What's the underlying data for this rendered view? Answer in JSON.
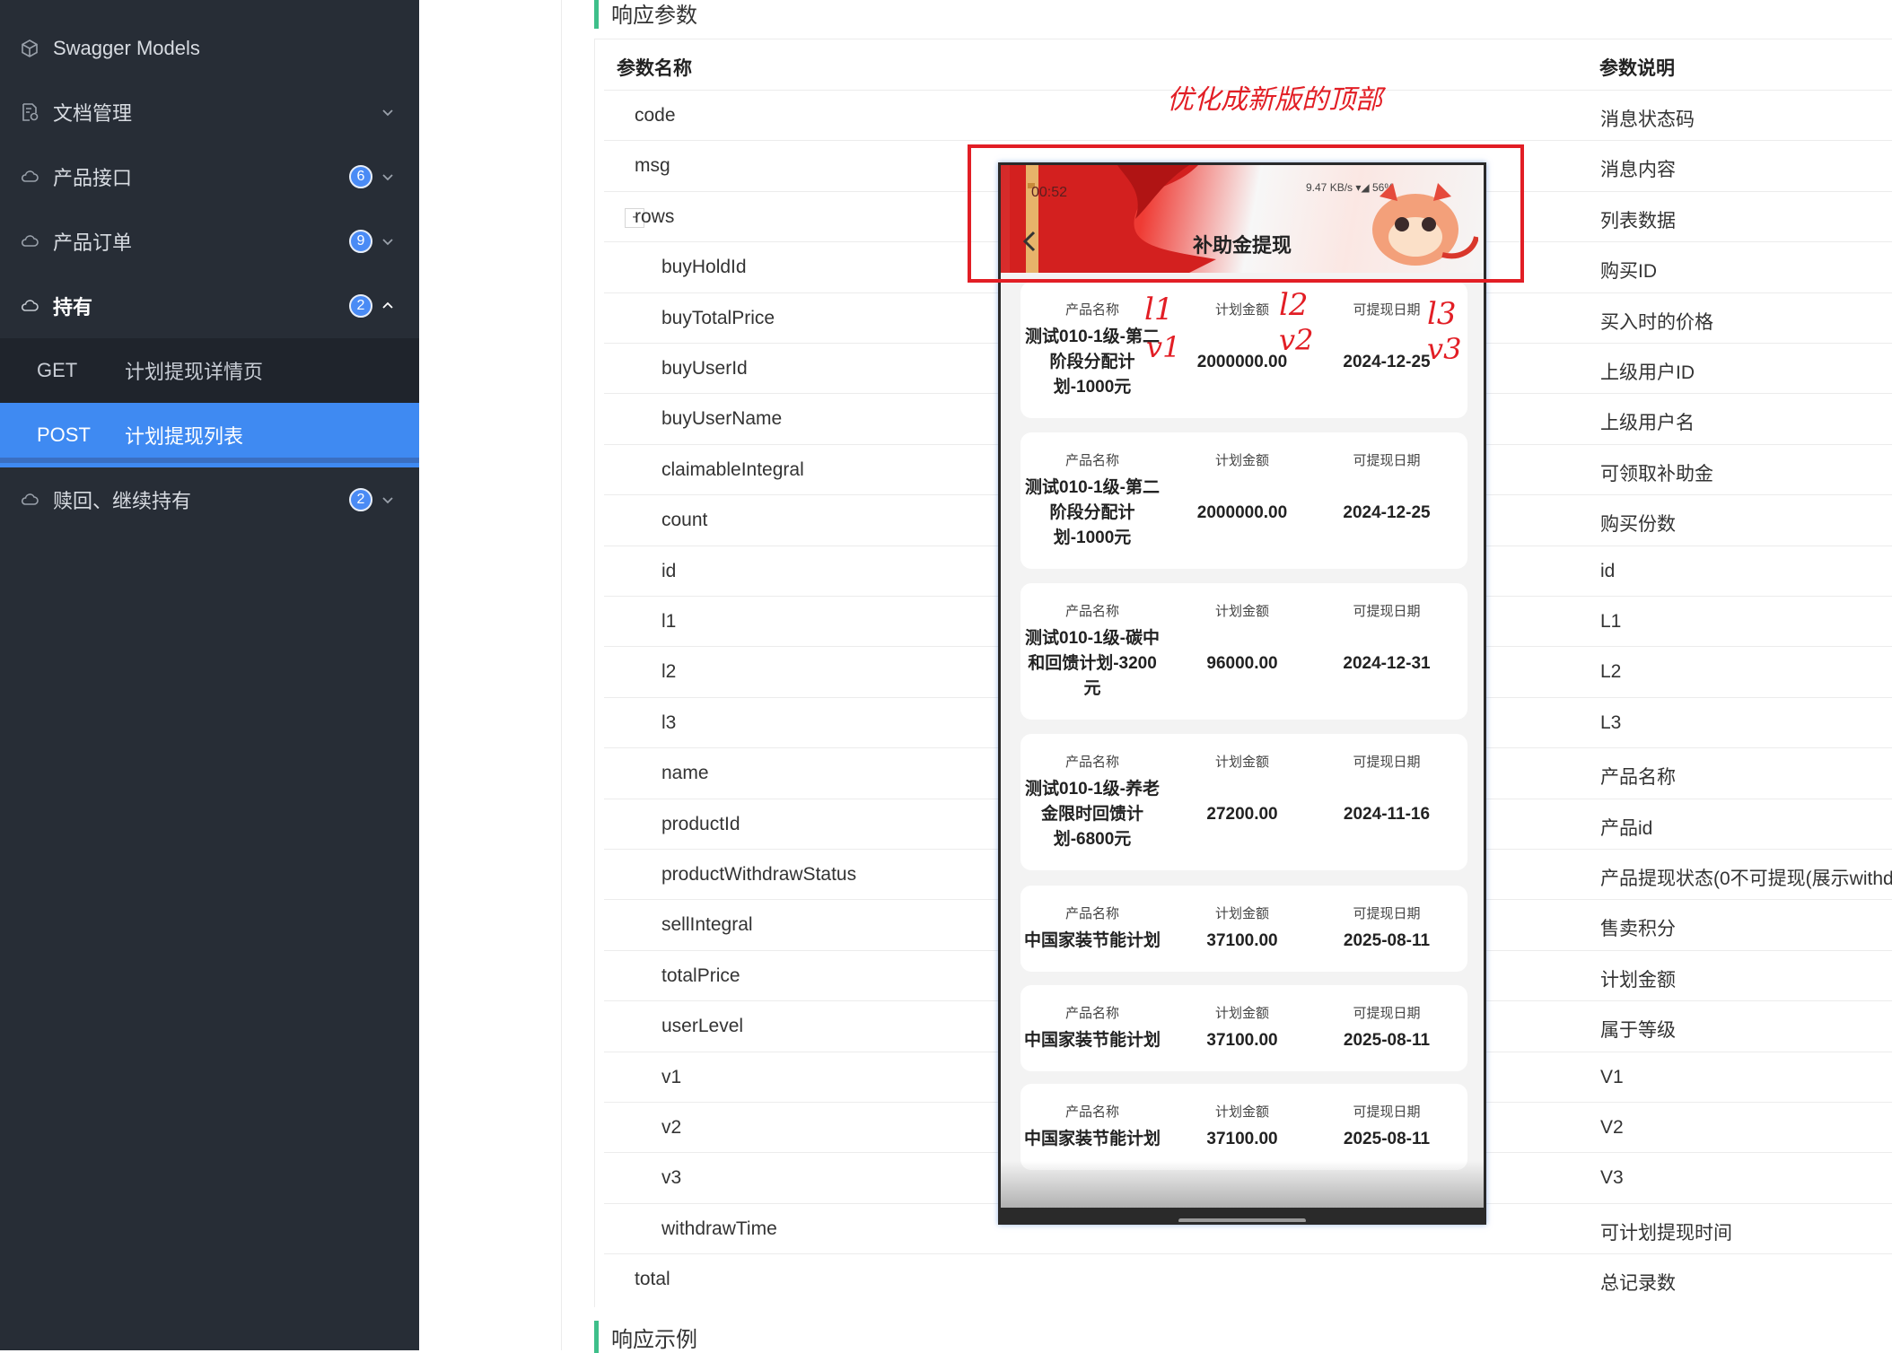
{
  "sidebar": {
    "items": [
      {
        "label": "Swagger Models",
        "badge": "",
        "icon": "cube-icon",
        "chevron": ""
      },
      {
        "label": "文档管理",
        "badge": "",
        "icon": "doc-settings-icon",
        "chevron": "down"
      },
      {
        "label": "产品接口",
        "badge": "6",
        "icon": "cloud-icon",
        "chevron": "down"
      },
      {
        "label": "产品订单",
        "badge": "9",
        "icon": "cloud-icon",
        "chevron": "down"
      },
      {
        "label": "持有",
        "badge": "2",
        "icon": "cloud-icon",
        "chevron": "up"
      },
      {
        "label": "赎回、继续持有",
        "badge": "2",
        "icon": "cloud-icon",
        "chevron": "down"
      }
    ],
    "sub_items": [
      {
        "method": "GET",
        "label": "计划提现详情页"
      },
      {
        "method": "POST",
        "label": "计划提现列表"
      }
    ]
  },
  "main": {
    "section_response": "响应参数",
    "section_example": "响应示例",
    "headers": {
      "name": "参数名称",
      "desc": "参数说明"
    },
    "rows": [
      {
        "name": "code",
        "desc": "消息状态码",
        "level": 1
      },
      {
        "name": "msg",
        "desc": "消息内容",
        "level": 1
      },
      {
        "name": "rows",
        "desc": "列表数据",
        "level": 1,
        "toggle": "-"
      },
      {
        "name": "buyHoldId",
        "desc": "购买ID",
        "level": 2
      },
      {
        "name": "buyTotalPrice",
        "desc": "买入时的价格",
        "level": 2
      },
      {
        "name": "buyUserId",
        "desc": "上级用户ID",
        "level": 2
      },
      {
        "name": "buyUserName",
        "desc": "上级用户名",
        "level": 2
      },
      {
        "name": "claimableIntegral",
        "desc": "可领取补助金",
        "level": 2
      },
      {
        "name": "count",
        "desc": "购买份数",
        "level": 2
      },
      {
        "name": "id",
        "desc": "id",
        "level": 2
      },
      {
        "name": "l1",
        "desc": "L1",
        "level": 2
      },
      {
        "name": "l2",
        "desc": "L2",
        "level": 2
      },
      {
        "name": "l3",
        "desc": "L3",
        "level": 2
      },
      {
        "name": "name",
        "desc": "产品名称",
        "level": 2
      },
      {
        "name": "productId",
        "desc": "产品id",
        "level": 2
      },
      {
        "name": "productWithdrawStatus",
        "desc": "产品提现状态(0不可提现(展示withd",
        "level": 2
      },
      {
        "name": "sellIntegral",
        "desc": "售卖积分",
        "level": 2
      },
      {
        "name": "totalPrice",
        "desc": "计划金额",
        "level": 2
      },
      {
        "name": "userLevel",
        "desc": "属于等级",
        "level": 2
      },
      {
        "name": "v1",
        "desc": "V1",
        "level": 2
      },
      {
        "name": "v2",
        "desc": "V2",
        "level": 2
      },
      {
        "name": "v3",
        "desc": "V3",
        "level": 2
      },
      {
        "name": "withdrawTime",
        "desc": "可计划提现时间",
        "level": 2
      },
      {
        "name": "total",
        "desc": "总记录数",
        "level": 1
      }
    ]
  },
  "phone": {
    "time": "00:52",
    "status": "9.47 KB/s",
    "battery": "56%",
    "title": "补助金提现",
    "headers": {
      "c1": "产品名称",
      "c2": "计划金额",
      "c3": "可提现日期"
    },
    "cards": [
      {
        "name": "测试010-1级-第二阶段分配计划-1000元",
        "amount": "2000000.00",
        "date": "2024-12-25"
      },
      {
        "name": "测试010-1级-第二阶段分配计划-1000元",
        "amount": "2000000.00",
        "date": "2024-12-25"
      },
      {
        "name": "测试010-1级-碳中和回馈计划-3200元",
        "amount": "96000.00",
        "date": "2024-12-31"
      },
      {
        "name": "测试010-1级-养老金限时回馈计划-6800元",
        "amount": "27200.00",
        "date": "2024-11-16"
      },
      {
        "name": "中国家装节能计划",
        "amount": "37100.00",
        "date": "2025-08-11"
      },
      {
        "name": "中国家装节能计划",
        "amount": "37100.00",
        "date": "2025-08-11"
      },
      {
        "name": "中国家装节能计划",
        "amount": "37100.00",
        "date": "2025-08-11"
      }
    ]
  },
  "annotations": {
    "note": "优化成新版的顶部",
    "l1": "l1",
    "v1": "v1",
    "l2": "l2",
    "v2": "v2",
    "l3": "l3",
    "v3": "v3"
  },
  "colors": {
    "sidebar": "#272d36",
    "active": "#3f8af2",
    "badge": "#4a8bf5",
    "section_bar": "#3ebf8a",
    "annotation": "#e21e25"
  }
}
